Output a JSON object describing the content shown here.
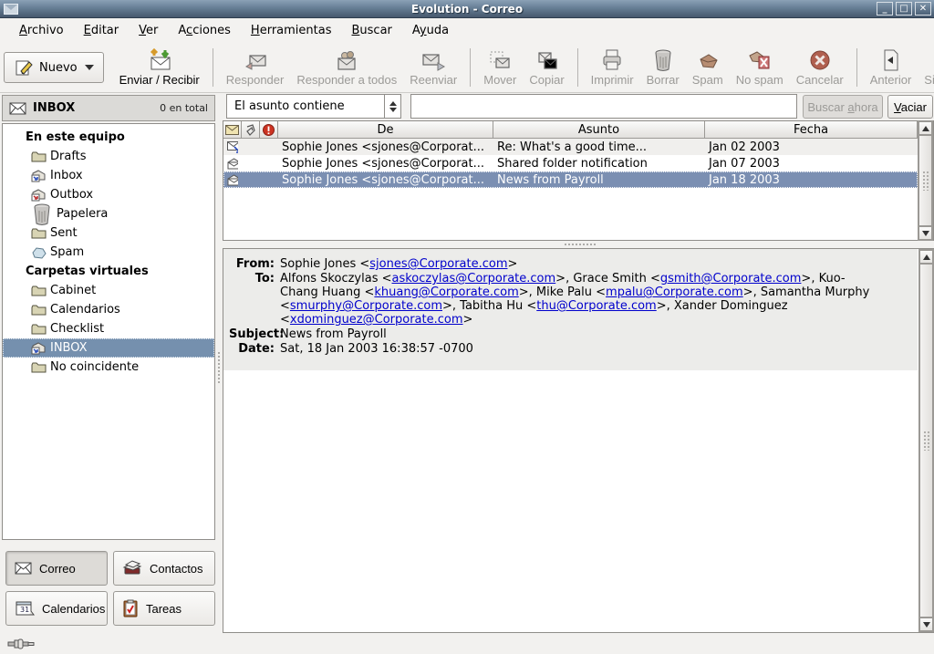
{
  "window": {
    "title": "Evolution - Correo",
    "controls": {
      "minimize": "_",
      "maximize": "▫",
      "close": "✕"
    }
  },
  "menubar": [
    {
      "label": "Archivo",
      "accel_index": 0
    },
    {
      "label": "Editar",
      "accel_index": 0
    },
    {
      "label": "Ver",
      "accel_index": 0
    },
    {
      "label": "Acciones",
      "accel_index": 1
    },
    {
      "label": "Herramientas",
      "accel_index": 0
    },
    {
      "label": "Buscar",
      "accel_index": 0
    },
    {
      "label": "Ayuda",
      "accel_index": 1
    }
  ],
  "toolbar": {
    "new_button": {
      "label": "Nuevo",
      "icon": "compose-icon",
      "enabled": true
    },
    "items": [
      {
        "type": "button",
        "id": "send-receive",
        "label": "Enviar / Recibir",
        "icon": "send-receive-icon",
        "enabled": true
      },
      {
        "type": "sep"
      },
      {
        "type": "button",
        "id": "reply",
        "label": "Responder",
        "icon": "reply-icon",
        "enabled": false
      },
      {
        "type": "button",
        "id": "reply-all",
        "label": "Responder a todos",
        "icon": "reply-all-icon",
        "enabled": false
      },
      {
        "type": "button",
        "id": "forward",
        "label": "Reenviar",
        "icon": "forward-icon",
        "enabled": false
      },
      {
        "type": "sep"
      },
      {
        "type": "button",
        "id": "move",
        "label": "Mover",
        "icon": "move-icon",
        "enabled": false
      },
      {
        "type": "button",
        "id": "copy",
        "label": "Copiar",
        "icon": "copy-icon",
        "enabled": false
      },
      {
        "type": "sep"
      },
      {
        "type": "button",
        "id": "print",
        "label": "Imprimir",
        "icon": "print-icon",
        "enabled": false
      },
      {
        "type": "button",
        "id": "delete",
        "label": "Borrar",
        "icon": "trash-icon",
        "enabled": false
      },
      {
        "type": "button",
        "id": "spam",
        "label": "Spam",
        "icon": "spam-icon",
        "enabled": false
      },
      {
        "type": "button",
        "id": "no-spam",
        "label": "No spam",
        "icon": "no-spam-icon",
        "enabled": false
      },
      {
        "type": "button",
        "id": "cancel",
        "label": "Cancelar",
        "icon": "cancel-icon",
        "enabled": false
      },
      {
        "type": "sep"
      },
      {
        "type": "button",
        "id": "previous",
        "label": "Anterior",
        "icon": "previous-icon",
        "enabled": false
      },
      {
        "type": "button",
        "id": "next",
        "label": "Siguiente",
        "icon": "next-icon",
        "enabled": false
      }
    ]
  },
  "sidebar": {
    "header": {
      "title": "INBOX",
      "count": "0 en total",
      "icon": "mail-icon"
    },
    "tree": [
      {
        "label": "En este equipo",
        "type": "group"
      },
      {
        "label": "Drafts",
        "icon": "folder-icon"
      },
      {
        "label": "Inbox",
        "icon": "inbox-icon"
      },
      {
        "label": "Outbox",
        "icon": "outbox-icon"
      },
      {
        "label": "Papelera",
        "icon": "trash-icon"
      },
      {
        "label": "Sent",
        "icon": "folder-icon"
      },
      {
        "label": "Spam",
        "icon": "spam-folder-icon"
      },
      {
        "label": "Carpetas virtuales",
        "type": "group"
      },
      {
        "label": "Cabinet",
        "icon": "folder-icon"
      },
      {
        "label": "Calendarios",
        "icon": "folder-icon"
      },
      {
        "label": "Checklist",
        "icon": "folder-icon"
      },
      {
        "label": "INBOX",
        "icon": "inbox-icon",
        "selected": true
      },
      {
        "label": "No coincidente",
        "icon": "folder-icon"
      }
    ],
    "switcher": [
      {
        "label": "Correo",
        "icon": "mail-icon",
        "active": true
      },
      {
        "label": "Contactos",
        "icon": "contacts-icon",
        "active": false
      },
      {
        "label": "Calendarios",
        "icon": "calendar-icon",
        "active": false
      },
      {
        "label": "Tareas",
        "icon": "tasks-icon",
        "active": false
      }
    ]
  },
  "search": {
    "filter_value": "El asunto contiene",
    "query_value": "",
    "search_button": {
      "label": "Buscar ahora",
      "accel_index": 7,
      "enabled": false
    },
    "clear_button": {
      "label": "Vaciar",
      "accel_index": 0,
      "enabled": true
    }
  },
  "message_list": {
    "status_columns": [
      "message-status-icon",
      "attachment-icon",
      "priority-icon"
    ],
    "columns": [
      "De",
      "Asunto",
      "Fecha"
    ],
    "rows": [
      {
        "from": "Sophie Jones <sjones@Corporat...",
        "subject": "Re: What's a good time...",
        "date": "Jan 02 2003",
        "icon": "replied-icon",
        "selected": false
      },
      {
        "from": "Sophie Jones <sjones@Corporat...",
        "subject": "Shared folder notification",
        "date": "Jan 07 2003",
        "icon": "read-icon",
        "selected": false
      },
      {
        "from": "Sophie Jones <sjones@Corporat...",
        "subject": "News from Payroll",
        "date": "Jan 18 2003",
        "icon": "read-icon",
        "selected": true
      }
    ]
  },
  "preview": {
    "fields": [
      {
        "label": "From:",
        "segments": [
          {
            "text": "Sophie Jones <"
          },
          {
            "text": "sjones@Corporate.com",
            "link": true
          },
          {
            "text": ">"
          }
        ]
      },
      {
        "label": "To:",
        "segments": [
          {
            "text": "Alfons Skoczylas <"
          },
          {
            "text": "askoczylas@Corporate.com",
            "link": true
          },
          {
            "text": ">, Grace Smith <"
          },
          {
            "text": "gsmith@Corporate.com",
            "link": true
          },
          {
            "text": ">, Kuo-Chang Huang <"
          },
          {
            "text": "khuang@Corporate.com",
            "link": true
          },
          {
            "text": ">, Mike Palu <"
          },
          {
            "text": "mpalu@Corporate.com",
            "link": true
          },
          {
            "text": ">, Samantha Murphy <"
          },
          {
            "text": "smurphy@Corporate.com",
            "link": true
          },
          {
            "text": ">, Tabitha Hu <"
          },
          {
            "text": "thu@Corporate.com",
            "link": true
          },
          {
            "text": ">, Xander Dominguez <"
          },
          {
            "text": "xdominguez@Corporate.com",
            "link": true
          },
          {
            "text": ">"
          }
        ]
      },
      {
        "label": "Subject:",
        "segments": [
          {
            "text": "News from Payroll"
          }
        ]
      },
      {
        "label": "Date:",
        "segments": [
          {
            "text": "Sat, 18 Jan 2003 16:38:57 -0700"
          }
        ]
      }
    ]
  },
  "colors": {
    "titlebar": "#677f96",
    "selection": "#7b8fb2",
    "link": "#0000cc",
    "disabled_text": "#9b9a97",
    "panel": "#f2f1ef"
  }
}
